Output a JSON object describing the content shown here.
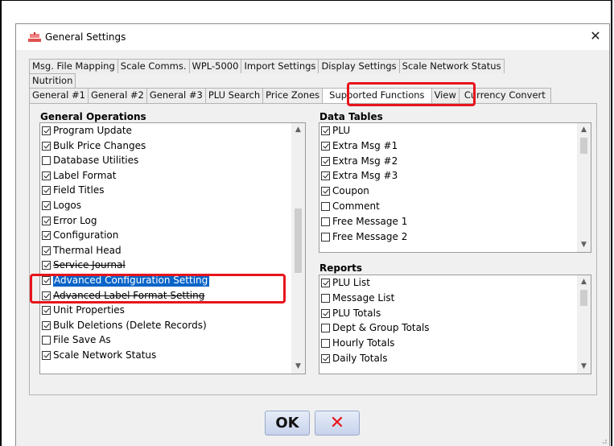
{
  "dialog": {
    "title": "General Settings",
    "close_label": "✕"
  },
  "tabs": {
    "row1": [
      "Msg. File Mapping",
      "Scale Comms.",
      "WPL-5000",
      "Import Settings",
      "Display Settings",
      "Scale Network Status"
    ],
    "row2": [
      "Nutrition"
    ],
    "row3": [
      "General #1",
      "General #2",
      "General #3",
      "PLU Search",
      "Price Zones",
      "Supported Functions",
      "View",
      "Currency Convert"
    ],
    "active": "Supported Functions"
  },
  "general_operations": {
    "title": "General Operations",
    "items": [
      {
        "label": "Program Update",
        "checked": true
      },
      {
        "label": "Bulk Price Changes",
        "checked": true
      },
      {
        "label": "Database Utilities",
        "checked": false
      },
      {
        "label": "Label Format",
        "checked": true
      },
      {
        "label": "Field Titles",
        "checked": true
      },
      {
        "label": "Logos",
        "checked": true
      },
      {
        "label": "Error Log",
        "checked": true
      },
      {
        "label": "Configuration",
        "checked": true
      },
      {
        "label": "Thermal Head",
        "checked": true
      },
      {
        "label": "Service Journal",
        "checked": true
      },
      {
        "label": "Advanced Configuration Setting",
        "checked": true
      },
      {
        "label": "Advanced Label Format Setting",
        "checked": true
      },
      {
        "label": "Unit Properties",
        "checked": true
      },
      {
        "label": "Bulk Deletions (Delete Records)",
        "checked": true
      },
      {
        "label": "File Save As",
        "checked": false
      },
      {
        "label": "Scale Network Status",
        "checked": true
      }
    ],
    "selected": "Advanced Configuration Setting"
  },
  "data_tables": {
    "title": "Data Tables",
    "items": [
      {
        "label": "PLU",
        "checked": true
      },
      {
        "label": "Extra Msg #1",
        "checked": true
      },
      {
        "label": "Extra Msg #2",
        "checked": true
      },
      {
        "label": "Extra Msg #3",
        "checked": true
      },
      {
        "label": "Coupon",
        "checked": true
      },
      {
        "label": "Comment",
        "checked": false
      },
      {
        "label": "Free Message 1",
        "checked": false
      },
      {
        "label": "Free Message 2",
        "checked": false
      }
    ]
  },
  "reports": {
    "title": "Reports",
    "items": [
      {
        "label": "PLU List",
        "checked": true
      },
      {
        "label": "Message List",
        "checked": false
      },
      {
        "label": "PLU Totals",
        "checked": true
      },
      {
        "label": "Dept & Group Totals",
        "checked": false
      },
      {
        "label": "Hourly Totals",
        "checked": false
      },
      {
        "label": "Daily Totals",
        "checked": true
      }
    ]
  },
  "buttons": {
    "ok_label": "OK",
    "cancel_icon": "red-x-icon"
  },
  "colors": {
    "highlight": "#e8141b",
    "selection": "#0a64c8"
  }
}
